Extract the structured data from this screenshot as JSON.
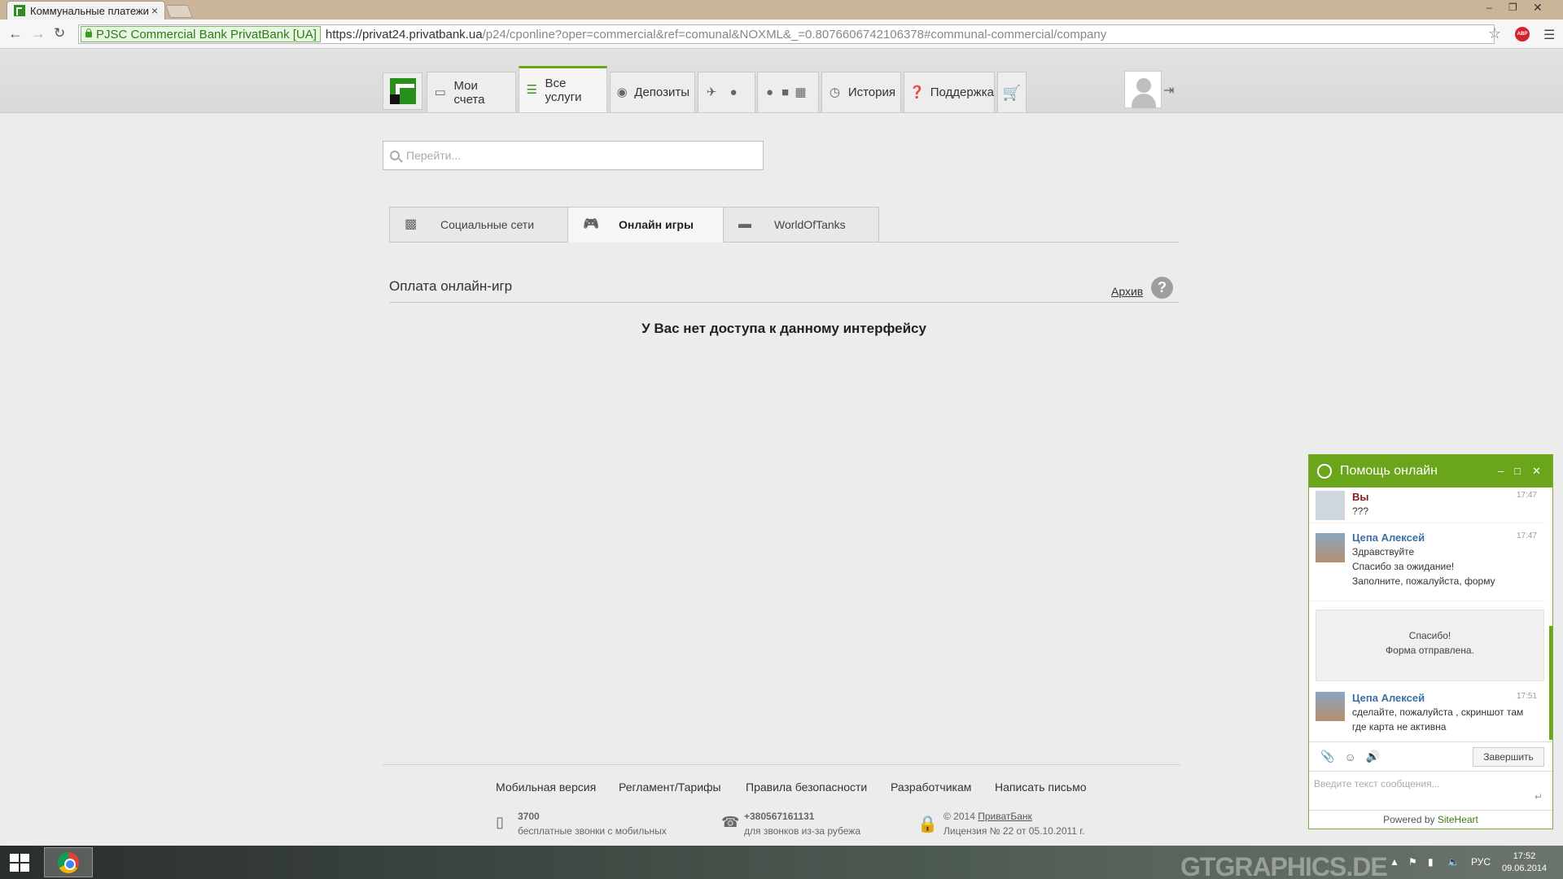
{
  "browser": {
    "tab_title": "Коммунальные платежи",
    "tab_close": "×",
    "ev_label": "PJSC Commercial Bank PrivatBank [UA]",
    "url_main": "https://privat24.privatbank.ua",
    "url_rest": "/p24/cponline?oper=commercial&ref=comunal&NOXML&_=0.8076606742106378#communal-commercial/company",
    "abp_label": "ABP"
  },
  "nav": {
    "items": [
      {
        "label": "Мои счета",
        "icon": "card-icon"
      },
      {
        "label": "Все услуги",
        "icon": "list-icon"
      },
      {
        "label": "Депозиты",
        "icon": "piggy-bank-icon"
      },
      {
        "label": "История",
        "icon": "clock-icon"
      },
      {
        "label": "Поддержка",
        "icon": "question-icon"
      }
    ]
  },
  "search": {
    "placeholder": "Перейти..."
  },
  "subtabs": [
    {
      "label": "Социальные сети"
    },
    {
      "label": "Онлайн игры"
    },
    {
      "label": "WorldOfTanks"
    }
  ],
  "section": {
    "title": "Оплата онлайн-игр",
    "archive": "Архив",
    "help": "?",
    "message": "У Вас нет доступа к данному интерфейсу"
  },
  "footer": {
    "links": [
      "Мобильная версия",
      "Регламент/Тарифы",
      "Правила безопасности",
      "Разработчикам",
      "Написать письмо"
    ],
    "phone1_num": "3700",
    "phone1_desc": "бесплатные звонки с мобильных",
    "phone2_num": "+380567161131",
    "phone2_desc": "для звонков из-за рубежа",
    "copyright": "© 2014",
    "bank_link": "ПриватБанк",
    "license": "Лицензия № 22 от 05.10.2011 г."
  },
  "chat": {
    "title": "Помощь онлайн",
    "messages": [
      {
        "name": "Вы",
        "time": "17:47",
        "lines": [
          "???"
        ]
      },
      {
        "name": "Цепа Алексей",
        "time": "17:47",
        "lines": [
          "Здравствуйте",
          "Спасибо за ожидание!",
          "Заполните, пожалуйста, форму"
        ]
      },
      {
        "name": "Цепа Алексей",
        "time": "17:51",
        "lines": [
          "сделайте, пожалуйста , скриншот там где карта не активна"
        ]
      }
    ],
    "form_sent_1": "Спасибо!",
    "form_sent_2": "Форма отправлена.",
    "end_button": "Завершить",
    "input_placeholder": "Введите текст сообщения...",
    "powered_prefix": "Powered by",
    "powered_brand": "SiteHeart"
  },
  "taskbar": {
    "watermark": "GTGRAPHICS.DE",
    "lang": "РУС",
    "time": "17:52",
    "date": "09.06.2014"
  }
}
